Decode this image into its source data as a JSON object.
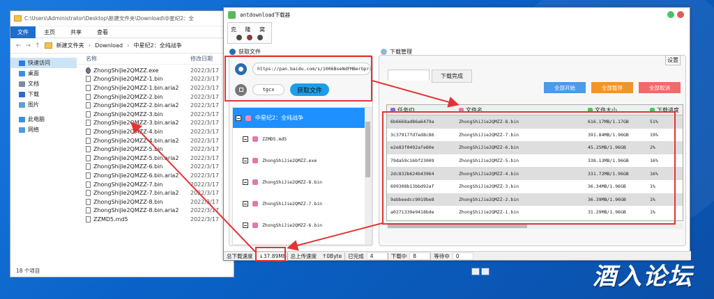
{
  "explorer": {
    "toolbar_path": "C:\\Users\\Administrator\\Desktop\\新建文件夹\\Download\\中星纪2：全",
    "ribbon": {
      "file": "文件",
      "home": "主页",
      "share": "共享",
      "view": "查看"
    },
    "breadcrumb": [
      "新建文件夹",
      "Download",
      "中星纪2：全纯战争"
    ],
    "nav_items": [
      {
        "label": "快速访问",
        "icon": "star-icon",
        "selected": true
      },
      {
        "label": "桌面",
        "icon": "desktop-icon"
      },
      {
        "label": "文档",
        "icon": "documents-icon"
      },
      {
        "label": "下载",
        "icon": "download-icon"
      },
      {
        "label": "图片",
        "icon": "pictures-icon"
      },
      {
        "label": "此电脑",
        "icon": "computer-icon"
      },
      {
        "label": "网络",
        "icon": "network-icon"
      }
    ],
    "col_name": "名称",
    "col_date": "修改日期",
    "files": [
      {
        "name": "ZhongShiJie2QMZZ.exe",
        "date": "2022/3/17",
        "type": "exe"
      },
      {
        "name": "ZhongShiJie2QMZZ-1.bin",
        "date": "2022/3/17",
        "type": "file"
      },
      {
        "name": "ZhongShiJie2QMZZ-1.bin.aria2",
        "date": "2022/3/17",
        "type": "file"
      },
      {
        "name": "ZhongShiJie2QMZZ-2.bin",
        "date": "2022/3/17",
        "type": "file"
      },
      {
        "name": "ZhongShiJie2QMZZ-2.bin.aria2",
        "date": "2022/3/17",
        "type": "file"
      },
      {
        "name": "ZhongShiJie2QMZZ-3.bin",
        "date": "2022/3/17",
        "type": "file"
      },
      {
        "name": "ZhongShiJie2QMZZ-3.bin.aria2",
        "date": "2022/3/17",
        "type": "file"
      },
      {
        "name": "ZhongShiJie2QMZZ-4.bin",
        "date": "2022/3/17",
        "type": "file"
      },
      {
        "name": "ZhongShiJie2QMZZ-4.bin.aria2",
        "date": "2022/3/17",
        "type": "file"
      },
      {
        "name": "ZhongShiJie2QMZZ-5.bin",
        "date": "2022/3/17",
        "type": "file"
      },
      {
        "name": "ZhongShiJie2QMZZ-5.bin.aria2",
        "date": "2022/3/17",
        "type": "file"
      },
      {
        "name": "ZhongShiJie2QMZZ-6.bin",
        "date": "2022/3/17",
        "type": "file"
      },
      {
        "name": "ZhongShiJie2QMZZ-6.bin.aria2",
        "date": "2022/3/17",
        "type": "file"
      },
      {
        "name": "ZhongShiJie2QMZZ-7.bin",
        "date": "2022/3/17",
        "type": "file"
      },
      {
        "name": "ZhongShiJie2QMZZ-7.bin.aria2",
        "date": "2022/3/17",
        "type": "file"
      },
      {
        "name": "ZhongShiJie2QMZZ-8.bin",
        "date": "2022/3/17",
        "type": "file"
      },
      {
        "name": "ZhongShiJie2QMZZ-8.bin.aria2",
        "date": "2022/3/17",
        "type": "file"
      },
      {
        "name": "ZZMD5.md5",
        "date": "2022/3/17",
        "type": "file"
      }
    ],
    "item_count": "18 个项目"
  },
  "app": {
    "title": "antdownload下载器",
    "toolbox_label": "克 隆 窝",
    "get_file_title": "获取文件",
    "url_value": "https://pan.baidu.com/s/1006BseNdFMBerGprrMtX3",
    "code_value": "tgcx",
    "get_file_button": "获取文件",
    "tree_root": "中星纪2：全纯战争",
    "tree_items": [
      "ZZMD5.md5",
      "ZhongShiJie2QMZZ.exe",
      "ZhongShiJie2QMZZ-8.bin",
      "ZhongShiJie2QMZZ-7.bin",
      "ZhongShiJie2QMZZ-6.bin",
      "ZhongShiJie2QMZZ-5.bin"
    ],
    "dl_manage_title": "下载管理",
    "settings_button": "设置",
    "tabs": [
      "下载中",
      "下载完成"
    ],
    "actions": [
      {
        "label": "全部开始",
        "color": "#4a9be8"
      },
      {
        "label": "全部暂停",
        "color": "#f0952c"
      },
      {
        "label": "全部取消",
        "color": "#f06a6a"
      }
    ],
    "table_headers": [
      "任务ID",
      "文件名",
      "文件大小",
      "下载进度"
    ],
    "rows": [
      {
        "id": "6b6668ad86a6479a",
        "name": "ZhongShiJie2QMZZ-8.bin",
        "size": "616.17MB/1.17GB",
        "progress": "51%"
      },
      {
        "id": "3c37917fd7ed8c86",
        "name": "ZhongShiJie2QMZZ-7.bin",
        "size": "391.84MB/1.96GB",
        "progress": "19%"
      },
      {
        "id": "e2e83f0492afe60e",
        "name": "ZhongShiJie2QMZZ-6.bin",
        "size": "45.25MB/1.96GB",
        "progress": "2%"
      },
      {
        "id": "79da59c16bf23009",
        "name": "ZhongShiJie2QMZZ-5.bin",
        "size": "338.13MB/1.96GB",
        "progress": "16%"
      },
      {
        "id": "2dc832b624b43964",
        "name": "ZhongShiJie2QMZZ-4.bin",
        "size": "331.72MB/1.96GB",
        "progress": "16%"
      },
      {
        "id": "699308b13bbd92af",
        "name": "ZhongShiJie2QMZZ-3.bin",
        "size": "36.34MB/1.96GB",
        "progress": "1%"
      },
      {
        "id": "9abbeedcc9019be8",
        "name": "ZhongShiJie2QMZZ-2.bin",
        "size": "36.39MB/1.96GB",
        "progress": "1%"
      },
      {
        "id": "a0271339e9418bde",
        "name": "ZhongShiJie2QMZZ-1.bin",
        "size": "31.29MB/1.96GB",
        "progress": "1%"
      }
    ],
    "status": {
      "dl_speed_label": "总下载速度",
      "dl_speed": "↓37.89MB",
      "ul_speed_label": "总上传速度",
      "ul_speed": "↑0Byte",
      "done_label": "已完成",
      "done": "4",
      "downloading_label": "下载中",
      "downloading": "8",
      "waiting_label": "等待中",
      "waiting": "0"
    }
  },
  "watermark": "酒入论坛"
}
